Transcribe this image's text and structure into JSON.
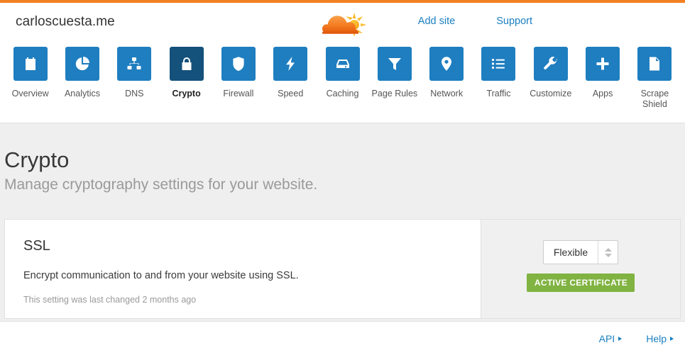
{
  "header": {
    "site_name": "carloscuesta.me",
    "logo": "cloudflare-cloud-sun-logo",
    "links": [
      {
        "label": "Add site",
        "name": "add-site-link"
      },
      {
        "label": "Support",
        "name": "support-link"
      }
    ]
  },
  "nav": {
    "items": [
      {
        "label": "Overview",
        "icon": "clipboard-icon",
        "active": false
      },
      {
        "label": "Analytics",
        "icon": "pie-chart-icon",
        "active": false
      },
      {
        "label": "DNS",
        "icon": "sitemap-icon",
        "active": false
      },
      {
        "label": "Crypto",
        "icon": "padlock-icon",
        "active": true
      },
      {
        "label": "Firewall",
        "icon": "shield-icon",
        "active": false
      },
      {
        "label": "Speed",
        "icon": "lightning-icon",
        "active": false
      },
      {
        "label": "Caching",
        "icon": "drive-icon",
        "active": false
      },
      {
        "label": "Page Rules",
        "icon": "funnel-icon",
        "active": false
      },
      {
        "label": "Network",
        "icon": "map-pin-icon",
        "active": false
      },
      {
        "label": "Traffic",
        "icon": "list-icon",
        "active": false
      },
      {
        "label": "Customize",
        "icon": "wrench-icon",
        "active": false
      },
      {
        "label": "Apps",
        "icon": "plus-icon",
        "active": false
      },
      {
        "label": "Scrape Shield",
        "icon": "document-icon",
        "active": false
      }
    ]
  },
  "page": {
    "title": "Crypto",
    "subtitle": "Manage cryptography settings for your website."
  },
  "ssl_card": {
    "title": "SSL",
    "description": "Encrypt communication to and from your website using SSL.",
    "note": "This setting was last changed 2 months ago",
    "select_value": "Flexible",
    "badge": "ACTIVE CERTIFICATE"
  },
  "footer": {
    "links": [
      {
        "label": "API",
        "name": "api-link"
      },
      {
        "label": "Help",
        "name": "help-link"
      }
    ]
  },
  "colors": {
    "brand_orange": "#f38020",
    "tile_blue": "#1f7ec0",
    "tile_active_blue": "#14517b",
    "link_blue": "#1a7fc1",
    "badge_green": "#80b341",
    "content_bg": "#efefef"
  }
}
